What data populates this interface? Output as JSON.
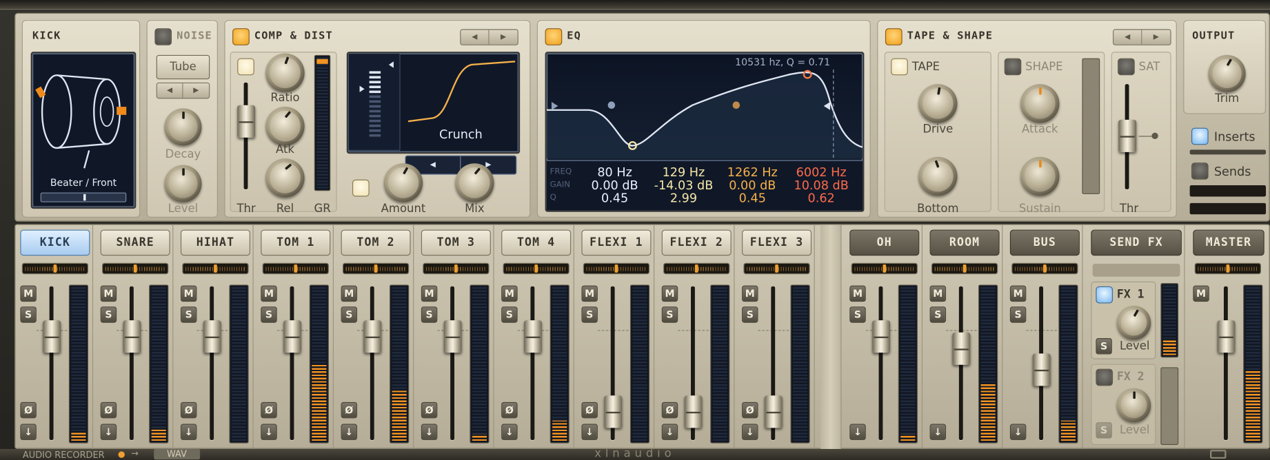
{
  "kick": {
    "title": "KICK",
    "mic_label": "Beater / Front"
  },
  "noise": {
    "title": "NOISE",
    "preset": "Tube",
    "decay_label": "Decay",
    "level_label": "Level"
  },
  "comp": {
    "title": "COMP & DIST",
    "ratio": "Ratio",
    "atk": "Atk",
    "rel": "Rel",
    "thr": "Thr",
    "gr": "GR",
    "curve_name": "Crunch",
    "amount": "Amount",
    "mix": "Mix"
  },
  "eq": {
    "title": "EQ",
    "readout": "10531 hz, Q = 0.71",
    "row_labels": [
      "FREQ",
      "GAIN",
      "Q"
    ],
    "bands": [
      {
        "freq": "80 Hz",
        "gain": "0.00 dB",
        "q": "0.45",
        "color": "#e8f0ff"
      },
      {
        "freq": "129 Hz",
        "gain": "-14.03 dB",
        "q": "2.99",
        "color": "#f4e6a8"
      },
      {
        "freq": "1262 Hz",
        "gain": "0.00 dB",
        "q": "0.45",
        "color": "#f5b04a"
      },
      {
        "freq": "6002 Hz",
        "gain": "10.08 dB",
        "q": "0.62",
        "color": "#ff6a4a"
      }
    ]
  },
  "tape": {
    "title": "TAPE & SHAPE",
    "tape": "TAPE",
    "drive": "Drive",
    "bottom": "Bottom",
    "shape": "SHAPE",
    "attack": "Attack",
    "sustain": "Sustain",
    "sat": "SAT",
    "thr": "Thr"
  },
  "output": {
    "title": "OUTPUT",
    "trim": "Trim",
    "inserts": "Inserts",
    "sends": "Sends"
  },
  "channels": [
    {
      "name": "KICK",
      "level": 0.06,
      "fader": 0.72
    },
    {
      "name": "SNARE",
      "level": 0.08,
      "fader": 0.72
    },
    {
      "name": "HIHAT",
      "level": 0.0,
      "fader": 0.72
    },
    {
      "name": "TOM 1",
      "level": 0.49,
      "fader": 0.72
    },
    {
      "name": "TOM 2",
      "level": 0.33,
      "fader": 0.72
    },
    {
      "name": "TOM 3",
      "level": 0.04,
      "fader": 0.72
    },
    {
      "name": "TOM 4",
      "level": 0.13,
      "fader": 0.72
    },
    {
      "name": "FLEXI 1",
      "level": 0.0,
      "fader": 0.1
    },
    {
      "name": "FLEXI 2",
      "level": 0.0,
      "fader": 0.1
    },
    {
      "name": "FLEXI 3",
      "level": 0.0,
      "fader": 0.1
    }
  ],
  "busses": [
    {
      "name": "OH",
      "level": 0.04,
      "fader": 0.72
    },
    {
      "name": "ROOM",
      "level": 0.36,
      "fader": 0.62
    },
    {
      "name": "BUS",
      "level": 0.13,
      "fader": 0.45
    }
  ],
  "send_fx": {
    "name": "SEND FX",
    "fx1": "FX 1",
    "fx2": "FX 2",
    "level": "Level",
    "s": "S"
  },
  "master": {
    "name": "MASTER",
    "level": 0.45,
    "fader": 0.72
  },
  "strip_buttons": {
    "mute": "M",
    "solo": "S",
    "phase": "Ø",
    "route": "↓"
  },
  "footer": {
    "recorder": "AUDIO RECORDER",
    "format": "WAV",
    "brand": "xlnaudio"
  }
}
